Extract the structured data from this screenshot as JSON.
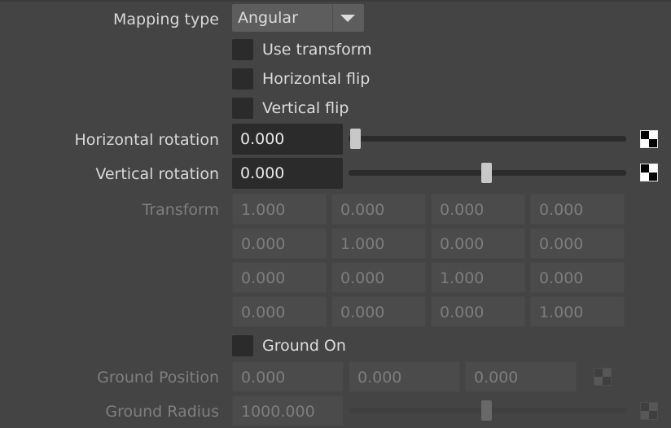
{
  "mapping_type": {
    "label": "Mapping type",
    "selected": "Angular"
  },
  "checkboxes": {
    "use_transform": "Use transform",
    "horizontal_flip": "Horizontal flip",
    "vertical_flip": "Vertical flip",
    "ground_on": "Ground On"
  },
  "horizontal_rotation": {
    "label": "Horizontal rotation",
    "value": "0.000",
    "slider_fraction": 0.0
  },
  "vertical_rotation": {
    "label": "Vertical rotation",
    "value": "0.000",
    "slider_fraction": 0.5
  },
  "transform": {
    "label": "Transform",
    "matrix": [
      [
        "1.000",
        "0.000",
        "0.000",
        "0.000"
      ],
      [
        "0.000",
        "1.000",
        "0.000",
        "0.000"
      ],
      [
        "0.000",
        "0.000",
        "1.000",
        "0.000"
      ],
      [
        "0.000",
        "0.000",
        "0.000",
        "1.000"
      ]
    ]
  },
  "ground_position": {
    "label": "Ground Position",
    "values": [
      "0.000",
      "0.000",
      "0.000"
    ]
  },
  "ground_radius": {
    "label": "Ground Radius",
    "value": "1000.000",
    "slider_fraction": 0.5
  },
  "icons": {
    "texture_map": "checker-texture-icon",
    "dropdown_arrow": "chevron-down-icon"
  },
  "colors": {
    "panel_bg": "#444444",
    "field_bg": "#2b2b2b",
    "disabled_text": "#7f7f7f"
  }
}
